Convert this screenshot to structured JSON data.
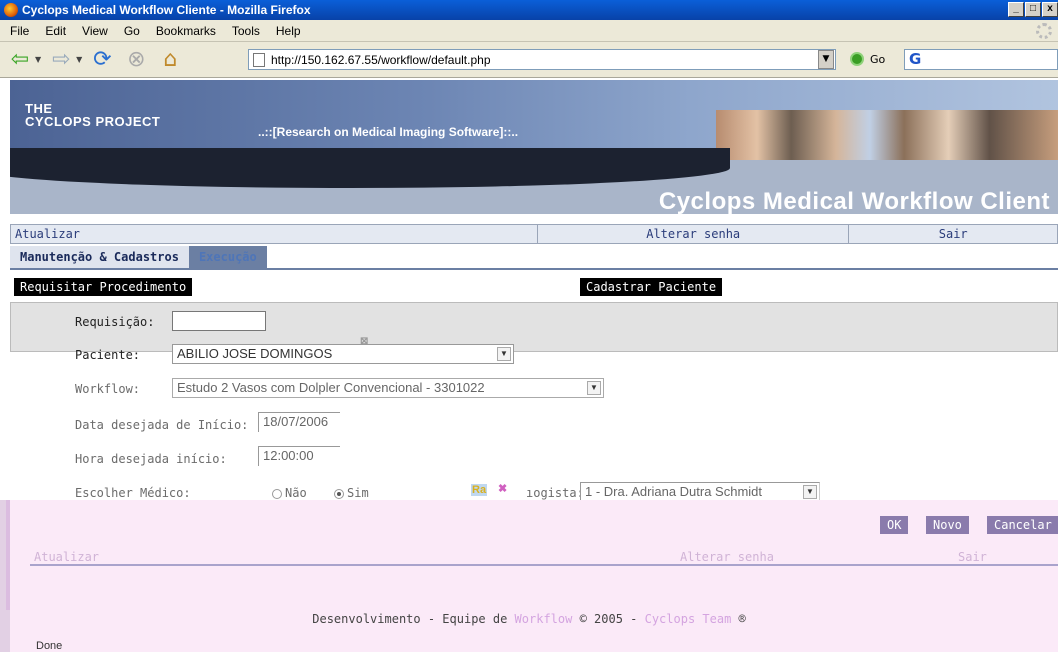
{
  "window": {
    "title": "Cyclops Medical Workflow Cliente - Mozilla Firefox",
    "buttons": [
      "_",
      "□",
      "x"
    ]
  },
  "menu": [
    "File",
    "Edit",
    "View",
    "Go",
    "Bookmarks",
    "Tools",
    "Help"
  ],
  "navbar": {
    "url": "http://150.162.67.55/workflow/default.php",
    "go_label": "Go",
    "search_glyph": "G"
  },
  "banner": {
    "logo_line1": "THE",
    "logo_line2": "CYCLOPS PROJECT",
    "tagline": "..::[Research on Medical Imaging Software]::..",
    "app_title": "Cyclops Medical Workflow Client"
  },
  "links": {
    "refresh": "Atualizar",
    "change_password": "Alterar senha",
    "logout": "Sair"
  },
  "tabs": [
    {
      "label": "Manutenção & Cadastros",
      "active": true
    },
    {
      "label": "Execução",
      "active": false
    }
  ],
  "actions": {
    "request_procedure": "Requisitar Procedimento",
    "register_patient": "Cadastrar Paciente"
  },
  "form": {
    "requisicao_label": "Requisição:",
    "requisicao_value": "",
    "paciente_label": "Paciente:",
    "paciente_value": "ABILIO JOSE DOMINGOS",
    "workflow_label": "Workflow:",
    "workflow_value": "Estudo 2 Vasos com Dolpler Convencional - 3301022",
    "data_label": "Data desejada de Início:",
    "data_value": "18/07/2006",
    "hora_label": "Hora desejada início:",
    "hora_value": "12:00:00",
    "medico_label": "Escolher Médico:",
    "radio_no": "Não",
    "radio_yes": "Sim",
    "radiologista_label": "ıogista:",
    "radiologista_value": "1 - Dra. Adriana Dutra Schmidt"
  },
  "buttons": {
    "ok": "OK",
    "novo": "Novo",
    "cancelar": "Cancelar"
  },
  "footer": {
    "prefix": "Desenvolvimento - Equipe de ",
    "workflow": "Workflow",
    "middle": " © 2005 - ",
    "team": "Cyclops Team",
    "suffix": " ®"
  },
  "status": "Done",
  "colors": {
    "title_bar": "#0842a8",
    "action_button": "#000000",
    "form_button": "#8a7bac"
  }
}
